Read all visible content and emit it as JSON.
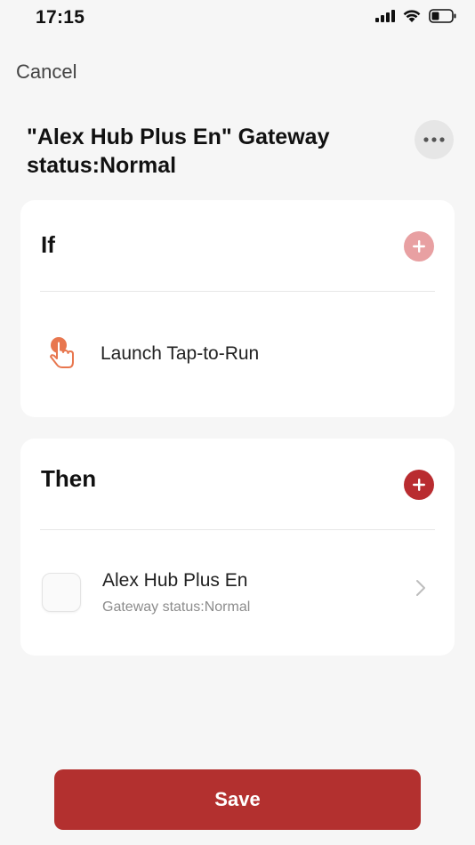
{
  "status_bar": {
    "time": "17:15",
    "icons": [
      "cellular-signal-icon",
      "wifi-icon",
      "battery-icon"
    ]
  },
  "nav": {
    "cancel_label": "Cancel",
    "more_icon": "ellipsis-icon"
  },
  "scene": {
    "title": "\"Alex Hub Plus En\" Gateway status:Normal"
  },
  "if_section": {
    "heading": "If",
    "add_icon": "plus-icon",
    "conditions": [
      {
        "icon": "tap-hand-icon",
        "label": "Launch Tap-to-Run"
      }
    ]
  },
  "then_section": {
    "heading": "Then",
    "add_icon": "plus-icon",
    "actions": [
      {
        "icon": "device-thumbnail",
        "title": "Alex Hub Plus En",
        "subtitle": "Gateway status:Normal"
      }
    ]
  },
  "footer": {
    "save_label": "Save"
  },
  "colors": {
    "accent": "#b3302f",
    "accent_disabled": "#e8a0a2",
    "tap_icon": "#e8774f",
    "background": "#f6f6f6",
    "card": "#ffffff"
  }
}
